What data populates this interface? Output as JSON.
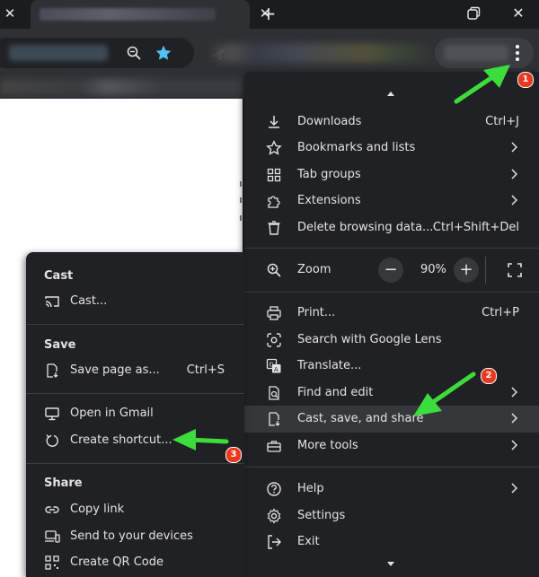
{
  "main_menu": {
    "items": [
      {
        "label": "Downloads",
        "shortcut": "Ctrl+J"
      },
      {
        "label": "Bookmarks and lists"
      },
      {
        "label": "Tab groups"
      },
      {
        "label": "Extensions"
      },
      {
        "label": "Delete browsing data...",
        "shortcut": "Ctrl+Shift+Del"
      }
    ],
    "zoom": {
      "label": "Zoom",
      "minus": "−",
      "value": "90%",
      "plus": "+"
    },
    "items2": [
      {
        "label": "Print...",
        "shortcut": "Ctrl+P"
      },
      {
        "label": "Search with Google Lens"
      },
      {
        "label": "Translate..."
      },
      {
        "label": "Find and edit"
      },
      {
        "label": "Cast, save, and share"
      },
      {
        "label": "More tools"
      }
    ],
    "items3": [
      {
        "label": "Help"
      },
      {
        "label": "Settings"
      },
      {
        "label": "Exit"
      }
    ]
  },
  "sub_menu": {
    "cast_header": "Cast",
    "cast_item": "Cast...",
    "save_header": "Save",
    "save_item": "Save page as...",
    "save_shortcut": "Ctrl+S",
    "open_gmail": "Open in Gmail",
    "create_shortcut": "Create shortcut...",
    "share_header": "Share",
    "copy_link": "Copy link",
    "send_devices": "Send to your devices",
    "qr_code": "Create QR Code"
  },
  "tabstrip": {
    "close_glyph": "✕",
    "new_tab_glyph": "+"
  },
  "annotations": {
    "badge1": "1",
    "badge2": "2",
    "badge3": "3"
  },
  "colors": {
    "arrow": "#3ddc3d",
    "badge": "#e8391f",
    "menu_bg": "#202124",
    "highlight": "#35373b",
    "star": "#4fc3f7"
  }
}
